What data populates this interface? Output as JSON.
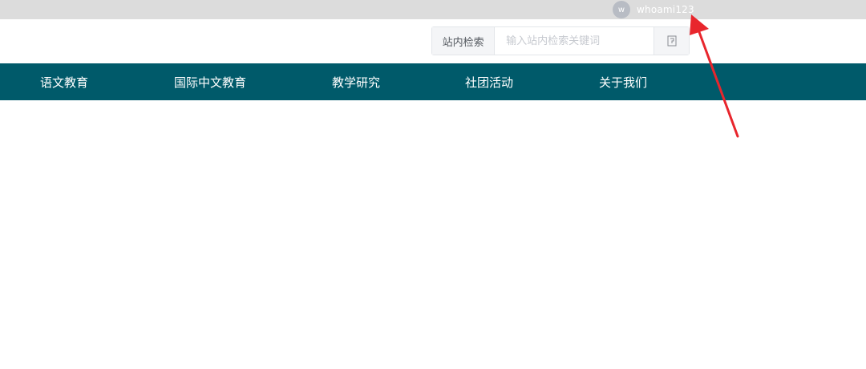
{
  "topbar": {
    "avatar_letter": "w",
    "username": "whoami123"
  },
  "search": {
    "label": "站内检索",
    "placeholder": "输入站内检索关键词",
    "button_icon": "search-submit-icon"
  },
  "nav": {
    "items": [
      {
        "label": "语文教育"
      },
      {
        "label": "国际中文教育"
      },
      {
        "label": "教学研究"
      },
      {
        "label": "社团活动"
      },
      {
        "label": "关于我们"
      }
    ]
  },
  "colors": {
    "topbar_bg": "#dcdcdc",
    "nav_bg": "#005a6a",
    "annotation_arrow": "#e8262d"
  }
}
